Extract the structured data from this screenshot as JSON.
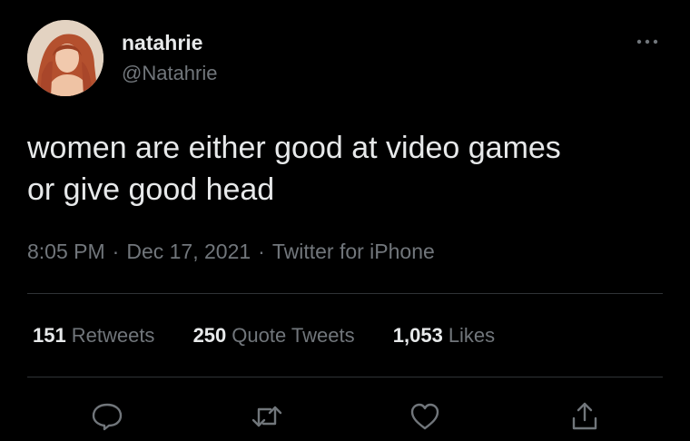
{
  "author": {
    "display_name": "natahrie",
    "handle": "@Natahrie",
    "avatar_icon": "profile-photo"
  },
  "tweet": {
    "text_lines": [
      "women are either good at video games",
      "or give good head"
    ],
    "time": "8:05 PM",
    "date": "Dec 17, 2021",
    "source": "Twitter for iPhone",
    "separator": "·"
  },
  "stats": {
    "retweets": {
      "count": "151",
      "label": "Retweets"
    },
    "quote_tweets": {
      "count": "250",
      "label": "Quote Tweets"
    },
    "likes": {
      "count": "1,053",
      "label": "Likes"
    }
  },
  "actions": {
    "reply_icon": "reply-icon",
    "retweet_icon": "retweet-icon",
    "like_icon": "heart-icon",
    "share_icon": "share-icon"
  },
  "colors": {
    "background": "#000000",
    "primary_text": "#e7e9ea",
    "secondary_text": "#71767b",
    "divider": "#2f3336"
  }
}
